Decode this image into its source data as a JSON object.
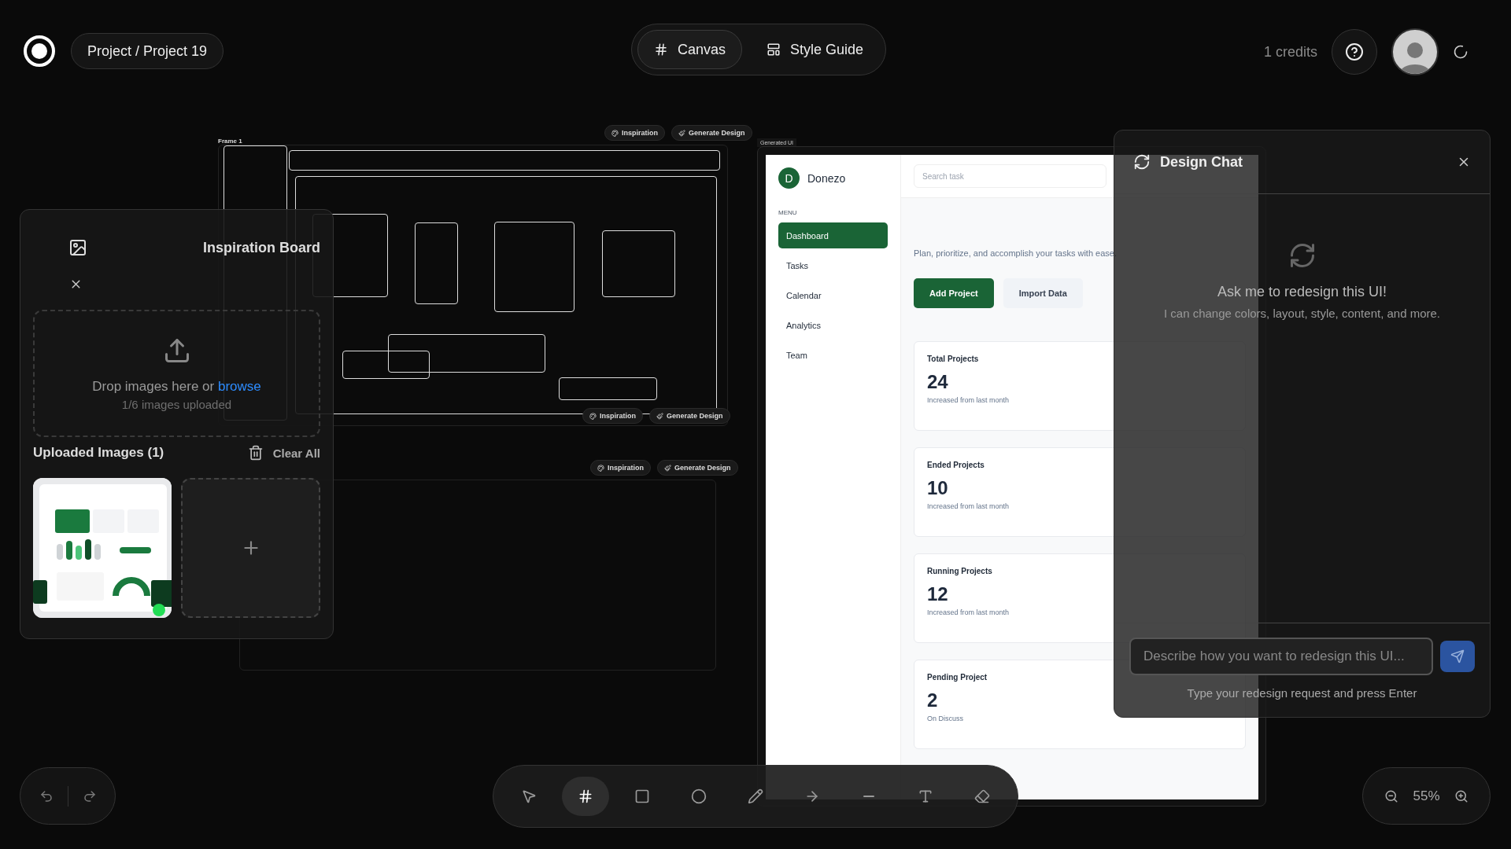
{
  "header": {
    "project": "Project / Project 19",
    "tabs": [
      {
        "label": "Canvas",
        "kind": "hash",
        "selected": true
      },
      {
        "label": "Style Guide",
        "kind": "layout",
        "selected": false
      }
    ],
    "credits": "1 credits"
  },
  "frames": [
    {
      "label": "Frame 1",
      "actions": [
        "Inspiration",
        "Generate Design"
      ]
    },
    {
      "actions": [
        "Inspiration",
        "Generate Design"
      ]
    },
    {
      "actions": [
        "Inspiration",
        "Generate Design"
      ]
    }
  ],
  "inspiration_board": {
    "title": "Inspiration Board",
    "drop_text": "Drop images here or",
    "browse": "browse",
    "count": "1/6 images uploaded",
    "uploaded_title": "Uploaded Images (1)",
    "clear": "Clear All"
  },
  "generated_ui": {
    "label": "Generated UI",
    "brand_initial": "D",
    "brand": "Donezo",
    "menu_title": "MENU",
    "menu": [
      {
        "label": "Dashboard",
        "selected": true
      },
      {
        "label": "Tasks",
        "selected": false
      },
      {
        "label": "Calendar",
        "selected": false
      },
      {
        "label": "Analytics",
        "selected": false
      },
      {
        "label": "Team",
        "selected": false
      }
    ],
    "search_placeholder": "Search task",
    "subtitle": "Plan, prioritize, and accomplish your tasks with ease.",
    "buttons": [
      {
        "label": "Add Project",
        "kind": "primary"
      },
      {
        "label": "Import Data",
        "kind": "secondary"
      }
    ],
    "stats": [
      {
        "label": "Total Projects",
        "value": "24",
        "note": "Increased from last month"
      },
      {
        "label": "Ended Projects",
        "value": "10",
        "note": "Increased from last month"
      },
      {
        "label": "Running Projects",
        "value": "12",
        "note": "Increased from last month"
      },
      {
        "label": "Pending Project",
        "value": "2",
        "note": "On Discuss"
      }
    ]
  },
  "design_chat": {
    "title": "Design Chat",
    "empty_title": "Ask me to redesign this UI!",
    "empty_text": "I can change colors, layout, style, content, and more.",
    "placeholder": "Describe how you want to redesign this UI...",
    "hint": "Type your redesign request and press Enter"
  },
  "tools": [
    {
      "kind": "select",
      "selected": false
    },
    {
      "kind": "frame",
      "selected": true
    },
    {
      "kind": "rectangle",
      "selected": false
    },
    {
      "kind": "ellipse",
      "selected": false
    },
    {
      "kind": "pencil",
      "selected": false
    },
    {
      "kind": "arrow",
      "selected": false
    },
    {
      "kind": "line",
      "selected": false
    },
    {
      "kind": "text",
      "selected": false
    },
    {
      "kind": "eraser",
      "selected": false
    }
  ],
  "zoom": "55%"
}
